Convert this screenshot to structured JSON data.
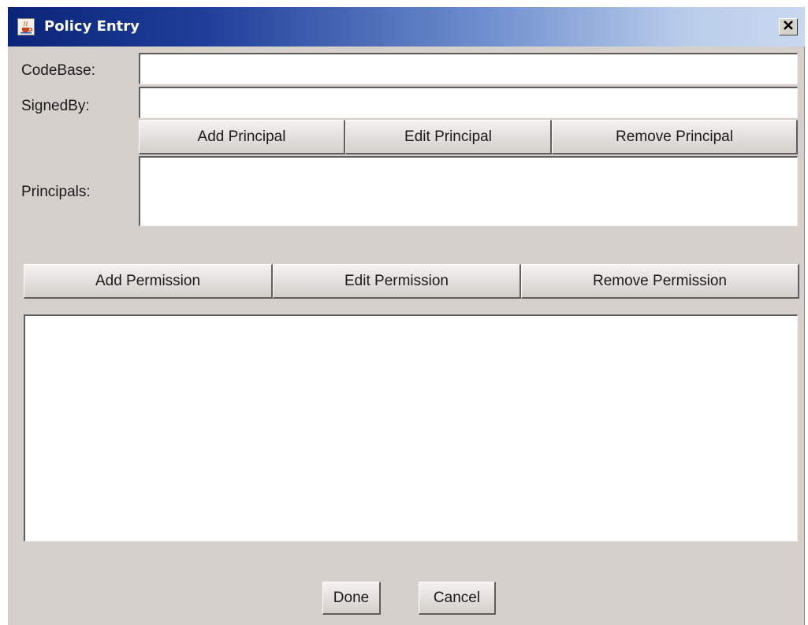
{
  "window": {
    "title": "Policy Entry",
    "icon": "java-cup-icon",
    "close_icon": "close-x-icon"
  },
  "form": {
    "codebase_label": "CodeBase:",
    "codebase_value": "",
    "signedby_label": "SignedBy:",
    "signedby_value": "",
    "principals_label": "Principals:"
  },
  "principal_buttons": {
    "add": "Add Principal",
    "edit": "Edit Principal",
    "remove": "Remove Principal"
  },
  "permission_buttons": {
    "add": "Add Permission",
    "edit": "Edit Permission",
    "remove": "Remove Permission"
  },
  "principals_list": [],
  "permissions_list": [],
  "footer": {
    "done": "Done",
    "cancel": "Cancel"
  },
  "colors": {
    "titlebar_start": "#0a2478",
    "titlebar_end": "#c9d8ef",
    "window_bg": "#d5d0cb"
  }
}
